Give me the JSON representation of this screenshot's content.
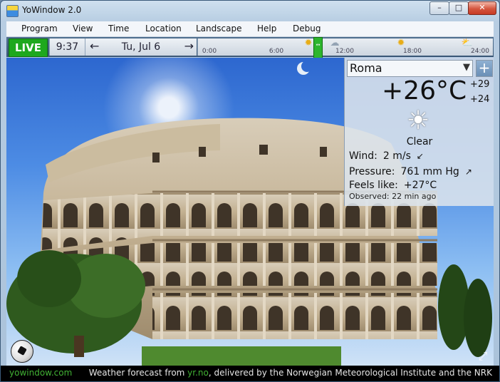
{
  "window": {
    "title": "YoWindow 2.0"
  },
  "window_buttons": {
    "minimize": "–",
    "maximize": "□",
    "close": "✕"
  },
  "menu": [
    "Program",
    "View",
    "Time",
    "Location",
    "Landscape",
    "Help",
    "Debug"
  ],
  "toolbar": {
    "live_label": "LIVE",
    "clock": "9:37",
    "date": "Tu, Jul 6",
    "prev_arrow": "←",
    "next_arrow": "→",
    "timeline_labels": [
      "0:00",
      "6:00",
      "12:00",
      "18:00",
      "24:00"
    ],
    "timeline_icons": [
      "sun-icon",
      "rain-cloud-icon",
      "sun-icon",
      "sun-cloud-icon"
    ]
  },
  "weather": {
    "city": "Roma",
    "temperature": "+26°C",
    "high": "+29",
    "low": "+24",
    "condition": "Clear",
    "condition_icon": "sun-icon",
    "wind_label": "Wind:",
    "wind_value": "2 m/s",
    "wind_dir": "↙",
    "pressure_label": "Pressure:",
    "pressure_value": "761 mm Hg",
    "pressure_dir": "↗",
    "feels_label": "Feels like:",
    "feels_value": "+27°C",
    "observed_label": "Observed:",
    "observed_value": "22 min ago"
  },
  "status": {
    "site": "yowindow.com",
    "credit_prefix": "Weather forecast from ",
    "credit_source": "yr.no",
    "credit_suffix": ", delivered by the Norwegian Meteorological Institute and the NRK"
  },
  "colors": {
    "live": "#1ea81e",
    "accent_link": "#41b234",
    "sky_top": "#2d67cf"
  }
}
